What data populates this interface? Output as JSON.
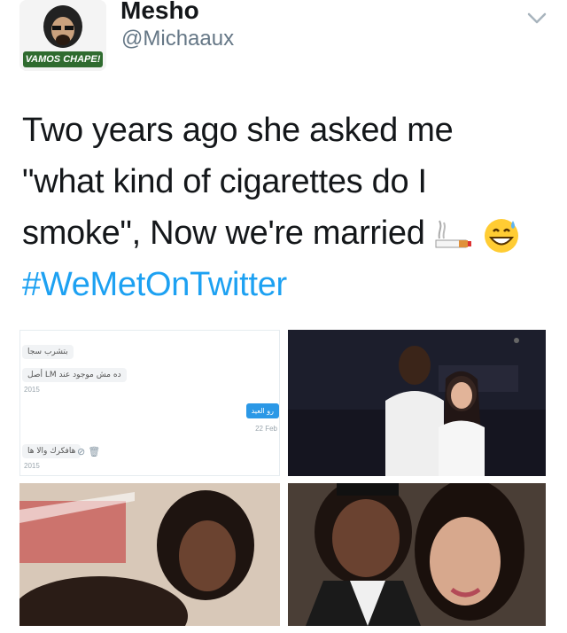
{
  "tweet": {
    "display_name": "Mesho",
    "handle": "@Michaaux",
    "avatar_badge": "VAMOS CHAPE!",
    "text_lines": [
      "Two years ago she asked me",
      "\"what kind of cigarettes do I",
      "smoke\", Now we're married"
    ],
    "emojis": [
      "cigarette-emoji",
      "grinning-sweat-emoji"
    ],
    "hashtag": "#WeMetOnTwitter"
  },
  "media": {
    "dm": {
      "msg1": "بتشرب سجا",
      "msg2": "أصل LM ده مش موجود عند",
      "time1": "2015",
      "reply": "رو العيد",
      "reply_time": "22 Feb",
      "msg3": "هافكرك والا ها",
      "time2": "2015"
    }
  },
  "colors": {
    "hashtag": "#1da1f2",
    "handle": "#657786",
    "text": "#14171a"
  }
}
